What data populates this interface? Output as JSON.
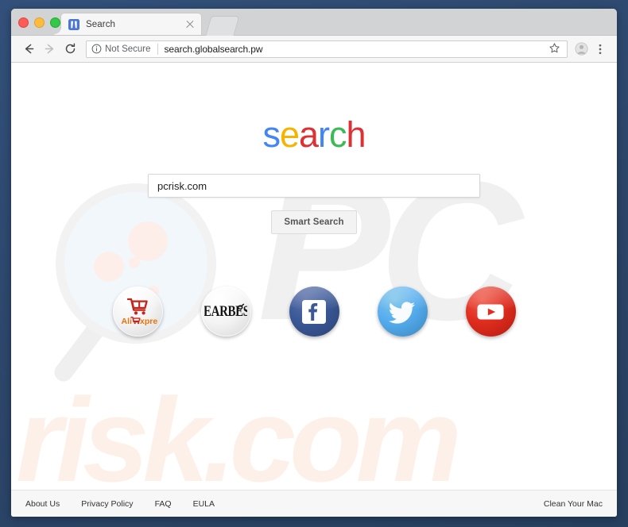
{
  "window": {
    "traffic_lights": [
      "close",
      "minimize",
      "zoom"
    ],
    "newtab_label": "New Tab"
  },
  "tab": {
    "title": "Search",
    "favicon_name": "search-globalsearch-favicon",
    "close_label": "Close tab"
  },
  "toolbar": {
    "back_label": "Back",
    "forward_label": "Forward",
    "reload_label": "Reload",
    "security_text": "Not Secure",
    "url": "search.globalsearch.pw",
    "bookmark_label": "Bookmark this page",
    "profile_label": "Profile",
    "menu_label": "Customize and control"
  },
  "page": {
    "logo": {
      "letters": [
        {
          "char": "s",
          "color": "#4285f4"
        },
        {
          "char": "e",
          "color": "#f4b400"
        },
        {
          "char": "a",
          "color": "#db3236"
        },
        {
          "char": "r",
          "color": "#4285f4"
        },
        {
          "char": "c",
          "color": "#3cba54"
        },
        {
          "char": "h",
          "color": "#db3236"
        }
      ],
      "text": "search"
    },
    "search": {
      "value": "pcrisk.com",
      "placeholder": "",
      "button_label": "Smart Search"
    },
    "shortcuts": [
      {
        "name": "aliexpress",
        "label": "AliExpress",
        "style": "plain",
        "color": "#e62e04"
      },
      {
        "name": "gearbest",
        "label": "GearBest",
        "style": "plain",
        "color": "#1a1a1a"
      },
      {
        "name": "facebook",
        "label": "Facebook",
        "style": "fb",
        "color": "#3b5998"
      },
      {
        "name": "twitter",
        "label": "Twitter",
        "style": "tw",
        "color": "#55acee"
      },
      {
        "name": "youtube",
        "label": "YouTube",
        "style": "yt",
        "color": "#e02d1f"
      }
    ],
    "watermarks": {
      "pc": "PC",
      "risk": "risk.com",
      "magnifier_name": "magnifier-watermark"
    },
    "footer": {
      "links": [
        {
          "label": "About Us"
        },
        {
          "label": "Privacy Policy"
        },
        {
          "label": "FAQ"
        },
        {
          "label": "EULA"
        }
      ],
      "right_link": {
        "label": "Clean Your Mac"
      }
    }
  }
}
